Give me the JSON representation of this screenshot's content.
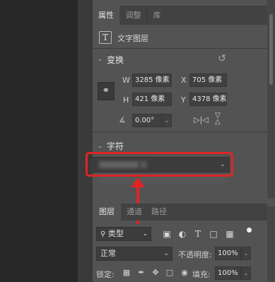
{
  "properties_tabs": [
    {
      "label": "属性",
      "active": true
    },
    {
      "label": "调整",
      "active": false
    },
    {
      "label": "库",
      "active": false
    }
  ],
  "layer_type": {
    "icon": "text-layer-icon",
    "glyph": "T",
    "label": "文字图层"
  },
  "transform": {
    "title": "变换",
    "w_label": "W",
    "w_value": "3285 像素",
    "x_label": "X",
    "x_value": "705 像素",
    "h_label": "H",
    "h_value": "421 像素",
    "y_label": "Y",
    "y_value": "4378 像素",
    "angle_value": "0.00°"
  },
  "character": {
    "title": "字符",
    "font_family_value": ""
  },
  "layers_tabs": [
    {
      "label": "图层",
      "active": true
    },
    {
      "label": "通道",
      "active": false
    },
    {
      "label": "路径",
      "active": false
    }
  ],
  "layers": {
    "filter_kind": "类型",
    "blend_mode": "正常",
    "opacity_label": "不透明度:",
    "opacity_value": "100%",
    "lock_label": "锁定:",
    "fill_label": "填充:",
    "fill_value": "100%"
  },
  "colors": {
    "annotation_red": "#e02424",
    "panel_bg": "#535353"
  }
}
